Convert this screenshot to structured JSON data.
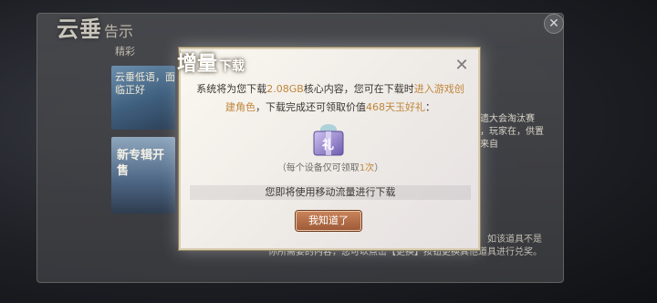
{
  "background": {
    "title": "云垂",
    "title_sub": "告示",
    "tab": "精彩",
    "banner_text": "云垂低语，面临正好",
    "banner2_text": "新专辑开售",
    "right_text": "夺遗大会淘汰赛时，玩家在，供置前来自",
    "bottom_text_line1": "如该道具不是",
    "bottom_text_line2": "你所需要的内容，您可以点击【更换】按钮更换其他道具进行兑奖。"
  },
  "dialog": {
    "title_big": "增量",
    "title_small": "下载",
    "message_part1": "系统将为您下载",
    "message_size": "2.08GB",
    "message_part2": "核心内容，您可在下载时",
    "message_link": "进入游戏创建角色",
    "message_part3": "，下载完成还可领取价值",
    "message_reward": "468天玉好礼",
    "message_part4": "：",
    "gift_label": "礼",
    "note_prefix": "（每个设备仅可领取",
    "note_count": "1次",
    "note_suffix": "）",
    "data_warning": "您即将使用移动流量进行下载",
    "confirm_label": "我知道了",
    "close_symbol": "✕"
  },
  "colors": {
    "highlight": "#c0863b",
    "button": "#b06b45"
  }
}
